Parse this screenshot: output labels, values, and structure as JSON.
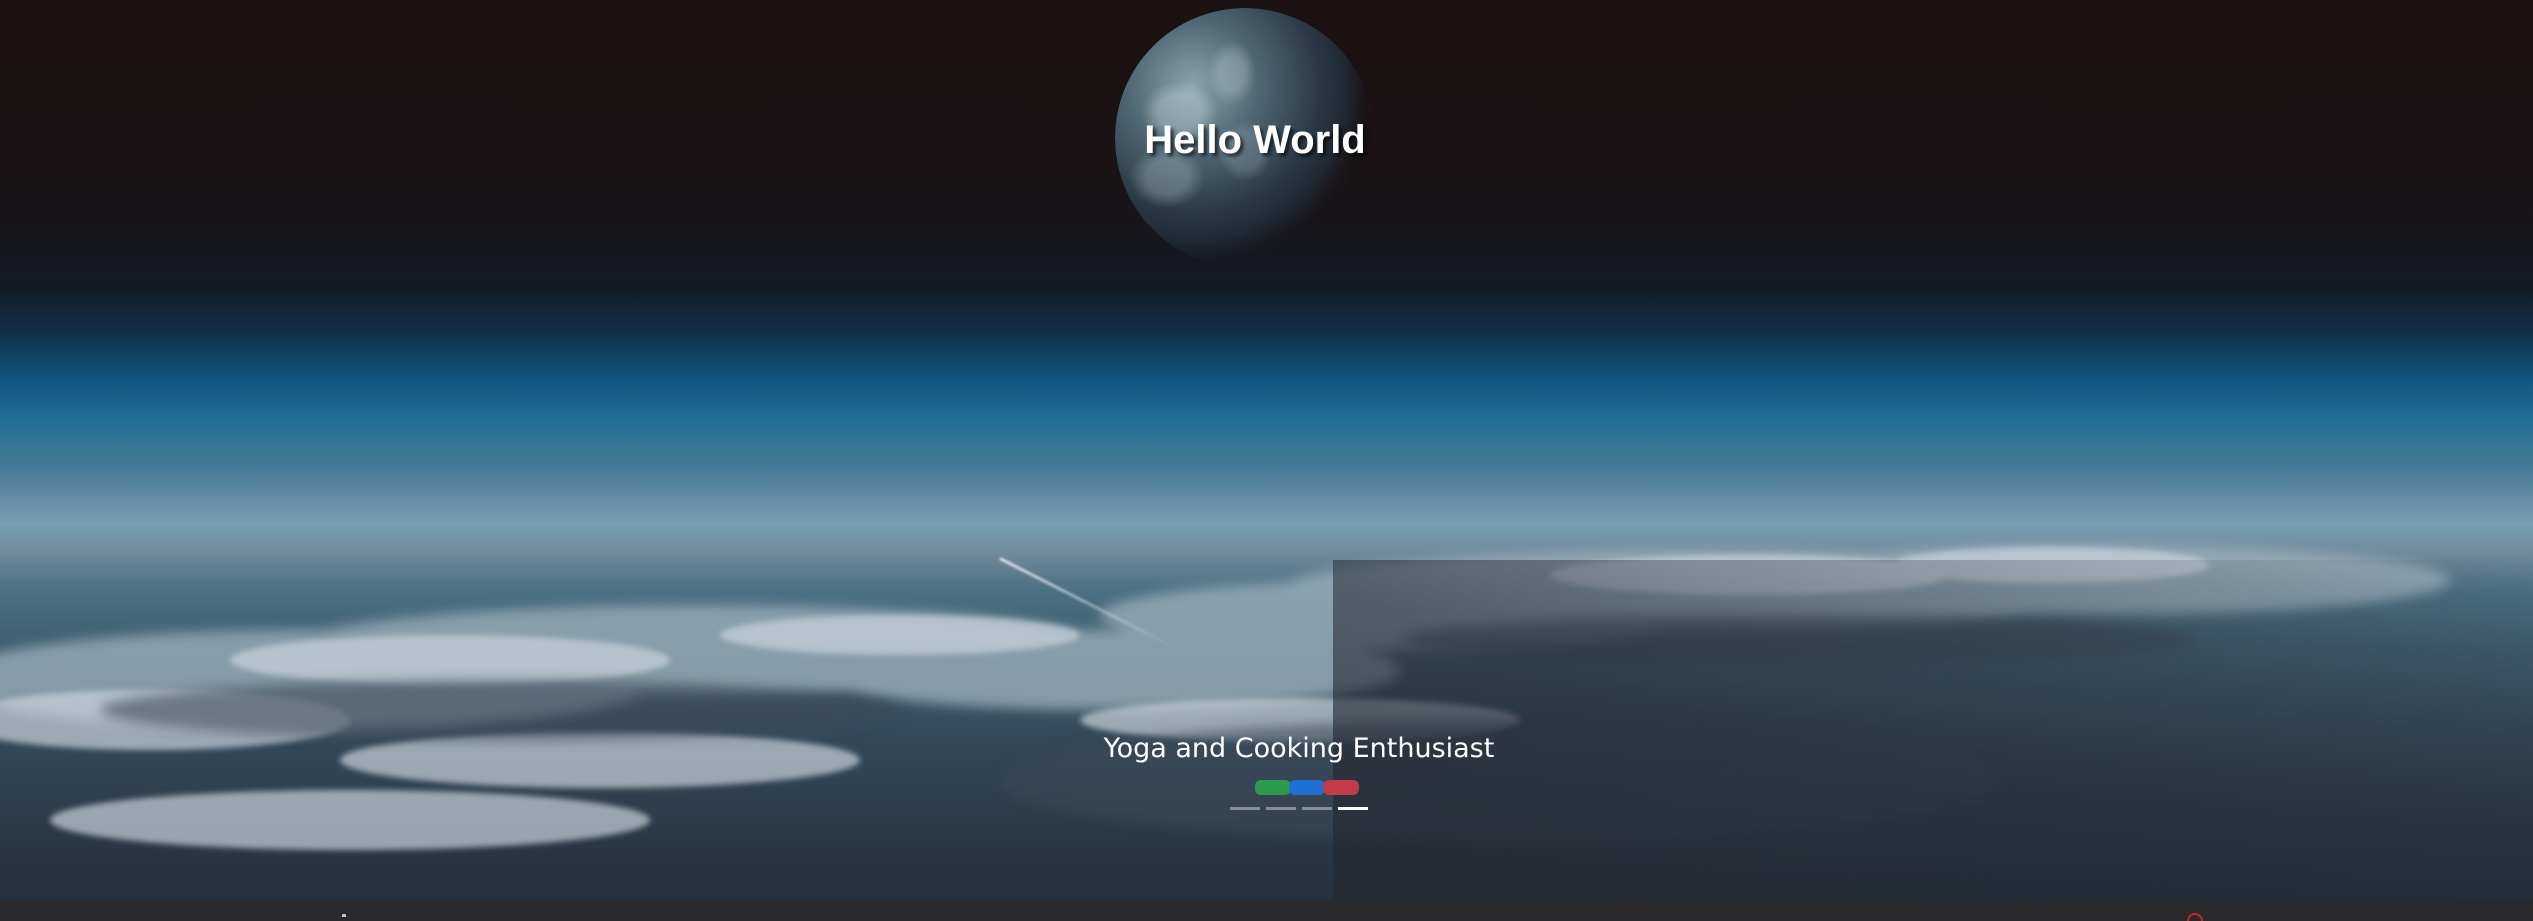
{
  "hero": {
    "title": "Hello World",
    "subtitle": "Yoga and Cooking Enthusiast",
    "pills": [
      {
        "color": "#2e9a4d",
        "name": "green"
      },
      {
        "color": "#1f6fd4",
        "name": "blue"
      },
      {
        "color": "#c23b47",
        "name": "red"
      }
    ],
    "indicators": {
      "count": 4,
      "active_index": 3
    }
  },
  "colors": {
    "footer": "#2a2a2c",
    "accent_red": "#d0202d"
  }
}
